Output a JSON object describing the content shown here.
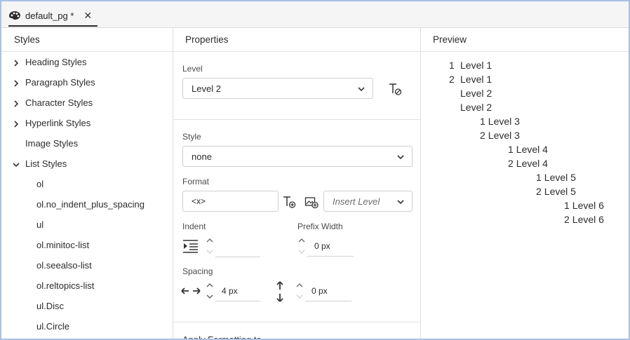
{
  "tab": {
    "title": "default_pg *",
    "close_glyph": "✕"
  },
  "styles_panel": {
    "header": "Styles",
    "items": [
      {
        "label": "Heading Styles",
        "expander": "collapsed"
      },
      {
        "label": "Paragraph Styles",
        "expander": "collapsed"
      },
      {
        "label": "Character Styles",
        "expander": "collapsed"
      },
      {
        "label": "Hyperlink Styles",
        "expander": "collapsed"
      },
      {
        "label": "Image Styles",
        "expander": "none"
      },
      {
        "label": "List Styles",
        "expander": "expanded"
      },
      {
        "label": "ol",
        "expander": "child"
      },
      {
        "label": "ol.no_indent_plus_spacing",
        "expander": "child"
      },
      {
        "label": "ul",
        "expander": "child"
      },
      {
        "label": "ol.minitoc-list",
        "expander": "child"
      },
      {
        "label": "ol.seealso-list",
        "expander": "child"
      },
      {
        "label": "ol.reltopics-list",
        "expander": "child"
      },
      {
        "label": "ul.Disc",
        "expander": "child"
      },
      {
        "label": "ul.Circle",
        "expander": "child"
      }
    ]
  },
  "properties_panel": {
    "header": "Properties",
    "level_label": "Level",
    "level_value": "Level 2",
    "style_label": "Style",
    "style_value": "none",
    "format_label": "Format",
    "format_value": "<x>",
    "insert_level_placeholder": "Insert Level",
    "indent_label": "Indent",
    "indent_value": "",
    "prefix_width_label": "Prefix Width",
    "prefix_width_value": "0 px",
    "spacing_label": "Spacing",
    "spacing_horizontal_value": "4 px",
    "spacing_vertical_value": "0 px",
    "cut_off_section_label": "Apply Formatting to"
  },
  "preview_panel": {
    "header": "Preview",
    "lines": [
      {
        "num": "1",
        "text": "Level 1",
        "depth": 0
      },
      {
        "num": "2",
        "text": "Level 1",
        "depth": 0
      },
      {
        "num": "",
        "text": "Level 2",
        "depth": 1
      },
      {
        "num": "",
        "text": "Level 2",
        "depth": 1
      },
      {
        "num": "1",
        "text": "Level 3",
        "depth": 2
      },
      {
        "num": "2",
        "text": "Level 3",
        "depth": 2
      },
      {
        "num": "1",
        "text": "Level 4",
        "depth": 3
      },
      {
        "num": "2",
        "text": "Level 4",
        "depth": 3
      },
      {
        "num": "1",
        "text": "Level 5",
        "depth": 4
      },
      {
        "num": "2",
        "text": "Level 5",
        "depth": 4
      },
      {
        "num": "1",
        "text": "Level 6",
        "depth": 5
      },
      {
        "num": "2",
        "text": "Level 6",
        "depth": 5
      }
    ]
  },
  "icons": {
    "tab": "palette-icon",
    "clear_format": "clear-format-icon",
    "insert_text": "insert-text-icon",
    "insert_image": "insert-image-icon",
    "indent": "indent-icon",
    "horizontal_spacing": "horizontal-spacing-icon",
    "vertical_spacing": "vertical-spacing-icon"
  },
  "colors": {
    "frame_border": "#a9c1e6",
    "accent": "#2c2c2c",
    "border": "#cfcfcf"
  }
}
